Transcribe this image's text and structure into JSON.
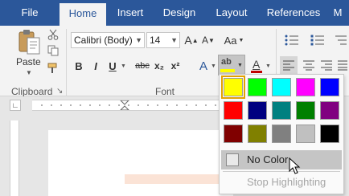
{
  "tabs": {
    "file": "File",
    "home": "Home",
    "insert": "Insert",
    "design": "Design",
    "layout": "Layout",
    "references": "References",
    "more": "M"
  },
  "clipboard": {
    "paste_label": "Paste",
    "group_label": "Clipboard",
    "launcher_glyph": "↘"
  },
  "font": {
    "family_value": "Calibri (Body)",
    "size_value": "14",
    "grow_glyph": "A",
    "shrink_glyph": "A",
    "case_glyph": "Aa",
    "bold_glyph": "B",
    "italic_glyph": "I",
    "underline_glyph": "U",
    "strike_glyph": "abc",
    "subscript_glyph": "x₂",
    "superscript_glyph": "x²",
    "text_effects_glyph": "A",
    "highlight_glyph": "ab",
    "font_color_glyph": "A",
    "group_label": "Font"
  },
  "highlight_menu": {
    "swatches": [
      [
        "#ffff00",
        "#00ff00",
        "#00ffff",
        "#ff00ff",
        "#0000ff"
      ],
      [
        "#ff0000",
        "#000080",
        "#008080",
        "#008000",
        "#800080"
      ],
      [
        "#800000",
        "#808000",
        "#808080",
        "#c0c0c0",
        "#000000"
      ]
    ],
    "no_color_label": "No Color",
    "stop_label": "Stop Highlighting",
    "selected_color": "#ffff00"
  },
  "colors": {
    "tab_bar": "#2b579a",
    "ribbon": "#f3f3f3"
  }
}
